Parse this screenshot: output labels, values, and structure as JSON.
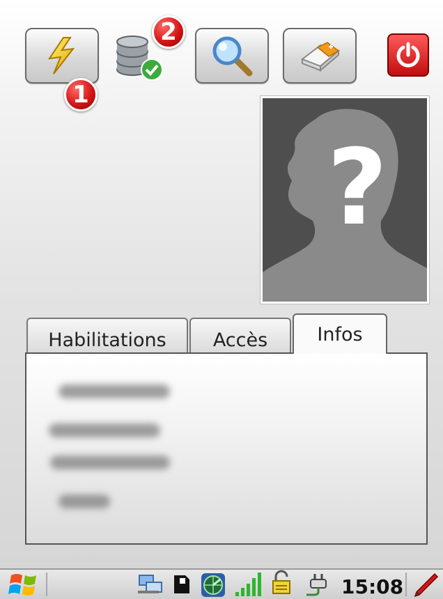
{
  "toolbar": {
    "buttons": [
      {
        "icon": "lightning-icon"
      },
      {
        "icon": "database-check-icon"
      },
      {
        "icon": "search-icon"
      },
      {
        "icon": "eraser-icon"
      },
      {
        "icon": "power-icon"
      }
    ],
    "badges": [
      "1",
      "2"
    ]
  },
  "photo": {
    "icon": "unknown-person-icon",
    "glyph": "?"
  },
  "tabs": [
    {
      "label": "Habilitations",
      "active": false
    },
    {
      "label": "Accès",
      "active": false
    },
    {
      "label": "Infos",
      "active": true
    }
  ],
  "taskbar": {
    "start_icon": "windows-flag-icon",
    "tray_icons": [
      "network-sync-icon",
      "sd-card-icon",
      "radar-icon",
      "signal-strength-icon",
      "lock-icon",
      "power-plug-icon",
      "pen-icon"
    ],
    "time": "15:08"
  },
  "colors": {
    "badge": "#d61616",
    "power": "#e02020"
  }
}
